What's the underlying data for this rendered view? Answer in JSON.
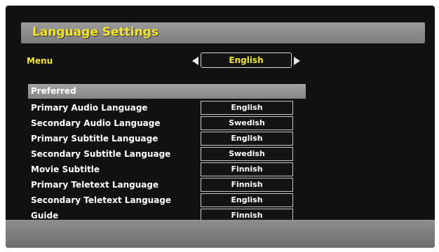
{
  "title": "Language Settings",
  "menu": {
    "label": "Menu",
    "value": "English"
  },
  "section_header": "Preferred",
  "settings": [
    {
      "label": "Primary Audio Language",
      "value": "English"
    },
    {
      "label": "Secondary Audio Language",
      "value": "Swedish"
    },
    {
      "label": "Primary Subtitle Language",
      "value": "English"
    },
    {
      "label": "Secondary Subtitle Language",
      "value": "Swedish"
    },
    {
      "label": "Movie Subtitle",
      "value": "Finnish"
    },
    {
      "label": "Primary Teletext Language",
      "value": "Finnish"
    },
    {
      "label": "Secondary Teletext Language",
      "value": "English"
    },
    {
      "label": "Guide",
      "value": "Finnish"
    }
  ],
  "icons": {
    "left_arrow": "left-arrow-icon",
    "right_arrow": "right-arrow-icon"
  },
  "colors": {
    "title_text": "#f2e52a",
    "menu_text": "#f2e52a",
    "background": "#111111",
    "bar": "#8a8a8a"
  }
}
